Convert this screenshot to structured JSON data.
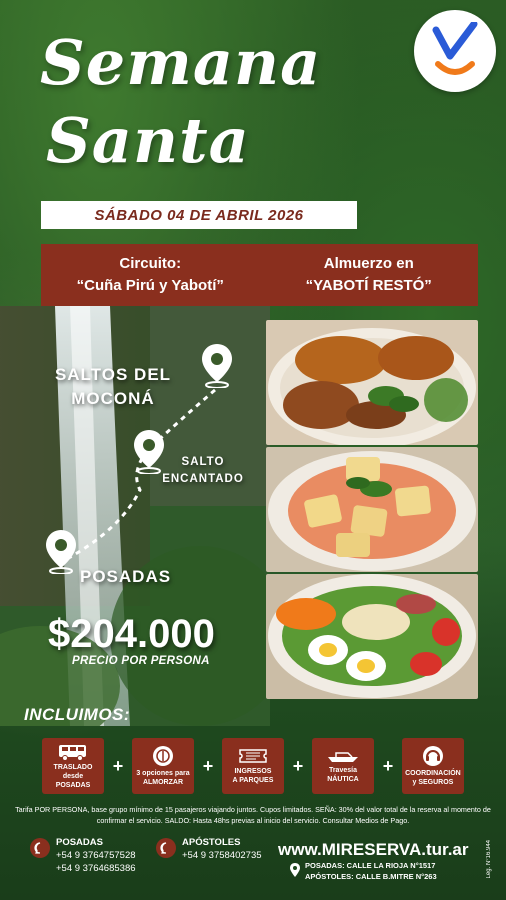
{
  "title": {
    "line1": "Semana",
    "line2": "Santa"
  },
  "date": "SÁBADO 04 DE ABRIL 2026",
  "banner": {
    "left_line1": "Circuito:",
    "left_line2": "“Cuña Pirú y Yabotí”",
    "right_line1": "Almuerzo en",
    "right_line2": "“YABOTÍ RESTÓ”"
  },
  "route": {
    "stop1_line1": "SALTOS DEL",
    "stop1_line2": "MOCONÁ",
    "stop2_line1": "SALTO",
    "stop2_line2": "ENCANTADO",
    "stop3": "POSADAS"
  },
  "price": {
    "amount": "$204.000",
    "note": "PRECIO POR PERSONA"
  },
  "includes": {
    "heading": "INCLUIMOS:",
    "items": [
      {
        "l1": "TRASLADO",
        "l2": "desde",
        "l3": "POSADAS",
        "icon": "bus-icon"
      },
      {
        "l1": "3 opciones para",
        "l2": "ALMORZAR",
        "l3": "",
        "icon": "plate-icon"
      },
      {
        "l1": "INGRESOS",
        "l2": "A PARQUES",
        "l3": "",
        "icon": "ticket-icon"
      },
      {
        "l1": "Travesía",
        "l2": "NÁUTICA",
        "l3": "",
        "icon": "boat-icon"
      },
      {
        "l1": "COORDINACIÓN",
        "l2": "y SEGUROS",
        "l3": "",
        "icon": "headset-icon"
      }
    ],
    "plus": "+"
  },
  "fine_print": "Tarifa POR PERSONA, base grupo mínimo de 15 pasajeros viajando juntos. Cupos limitados. SEÑA: 30% del valor total de la reserva al momento de confirmar el servicio. SALDO: Hasta 48hs previas al inicio del servicio. Consultar Medios de Pago.",
  "contacts": {
    "posadas_label": "POSADAS",
    "posadas_phone1": "+54 9 3764757528",
    "posadas_phone2": "+54 9 3764685386",
    "apostoles_label": "APÓSTOLES",
    "apostoles_phone": "+54 9 3758402735"
  },
  "website": "www.MIRESERVA.tur.ar",
  "address1": "POSADAS: CALLE LA RIOJA N°1517",
  "address2": "APÓSTOLES: CALLE B.MITRE N°263",
  "legajo": "Leg. N°16.944",
  "colors": {
    "accent": "#8a2f1e",
    "logo_blue": "#2a5bd7",
    "logo_orange": "#f07a1a"
  }
}
